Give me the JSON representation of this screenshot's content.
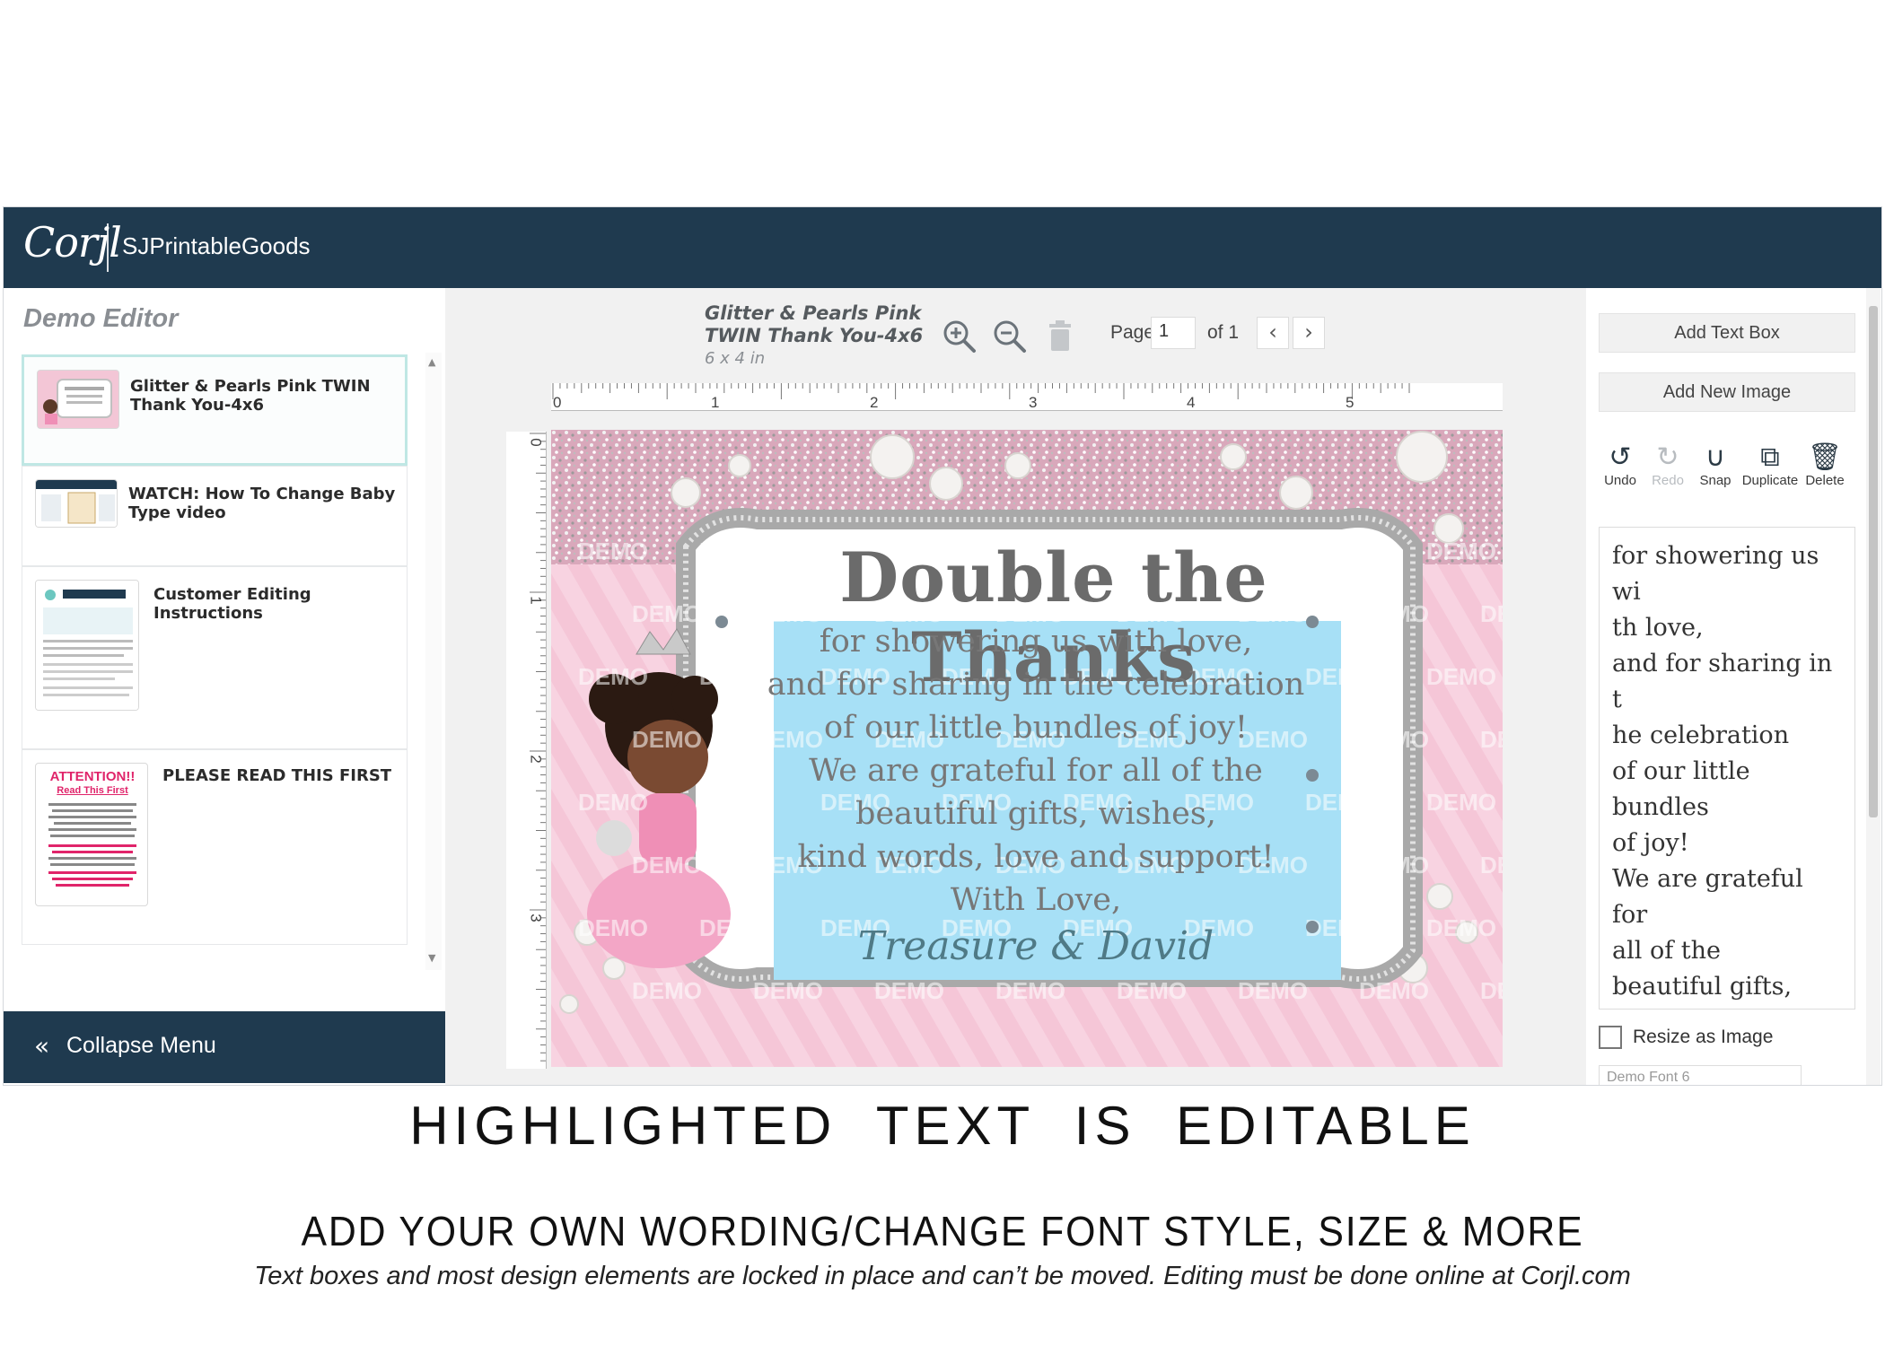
{
  "app": {
    "logo": "Corjl",
    "shop_name": "SJPrintableGoods"
  },
  "left_panel": {
    "heading": "Demo Editor",
    "templates": [
      {
        "title": "Glitter & Pearls Pink TWIN Thank You-4x6",
        "selected": true
      },
      {
        "title": "WATCH: How To Change Baby Type video",
        "selected": false
      },
      {
        "title": "Customer Editing Instructions",
        "selected": false
      },
      {
        "title": "PLEASE READ THIS FIRST",
        "selected": false,
        "thumb_heading": "ATTENTION!!",
        "thumb_sub": "Read This First"
      }
    ],
    "collapse_label": "Collapse Menu"
  },
  "toolbar": {
    "doc_title": "Glitter & Pearls Pink TWIN Thank You-4x6",
    "doc_size": "6 x 4 in",
    "page_label": "Page",
    "page_value": "1",
    "page_of": "of 1",
    "icons": [
      "zoom-in-icon",
      "zoom-out-icon",
      "trash-icon",
      "chevron-left-icon",
      "chevron-right-icon"
    ]
  },
  "rulers": {
    "horizontal": [
      "0",
      "1",
      "2",
      "3",
      "4",
      "5"
    ],
    "vertical": [
      "0",
      "1",
      "2",
      "3"
    ]
  },
  "card": {
    "title": "Double the Thanks",
    "lines": [
      "for showering us with love,",
      "and for sharing in the celebration",
      "of our little bundles of joy!",
      "We are grateful for all of the",
      "beautiful gifts, wishes,",
      "kind words, love and support!",
      "With Love,"
    ],
    "signature": "Treasure & David",
    "watermark": "DEMO",
    "colors": {
      "background": "#f5c6d7",
      "highlight": "#a7e0f6",
      "frame": "#c0c0c0"
    }
  },
  "right_panel": {
    "add_text_box": "Add Text Box",
    "add_new_image": "Add New Image",
    "tools": [
      {
        "label": "Undo",
        "icon": "undo-icon",
        "enabled": true
      },
      {
        "label": "Redo",
        "icon": "redo-icon",
        "enabled": false
      },
      {
        "label": "Snap",
        "icon": "magnet-icon",
        "enabled": true
      },
      {
        "label": "Duplicate",
        "icon": "duplicate-icon",
        "enabled": true
      },
      {
        "label": "Delete",
        "icon": "trash-icon",
        "enabled": true
      }
    ],
    "text_value": "for showering us wi\nth love,\nand for sharing in t\nhe celebration\nof our little bundles\nof joy!\nWe are grateful for\nall of the\nbeautiful gifts, wish\nes,\nkind words, love and\nsupport!\nWith Love,",
    "resize_as_image": "Resize as Image",
    "font_select": "Demo Font 6"
  },
  "captions": {
    "headline": "HIGHLIGHTED TEXT IS EDITABLE",
    "subhead": "ADD YOUR OWN WORDING/CHANGE FONT STYLE, SIZE & MORE",
    "note": "Text boxes and most design elements are locked in place and can’t be moved. Editing must be done online at Corjl.com"
  }
}
